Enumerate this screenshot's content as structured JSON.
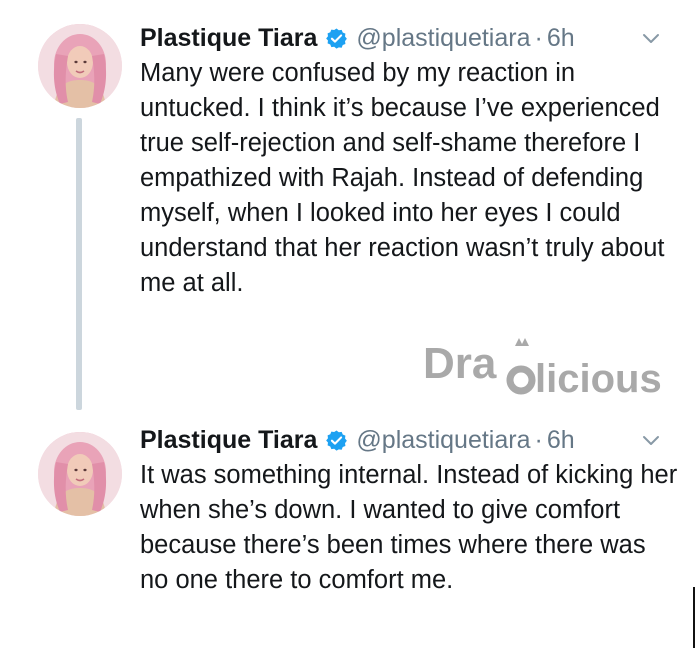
{
  "tweets": [
    {
      "name": "Plastique Tiara",
      "handle": "@plastiquetiara",
      "separator": "·",
      "time": "6h",
      "text": "Many were confused by my reaction in untucked. I think it’s because I’ve experienced true self-rejection and self-shame therefore I empathized with Rajah. Instead of defending myself, when I looked into her eyes I could understand that her reaction wasn’t truly about me at all."
    },
    {
      "name": "Plastique Tiara",
      "handle": "@plastiquetiara",
      "separator": "·",
      "time": "6h",
      "text": "It was something internal. Instead of kicking her when she’s down. I wanted to give comfort because there’s been times where there was no one there to comfort me."
    }
  ],
  "watermark": "Draglicious",
  "colors": {
    "verified": "#1da1f2",
    "secondary_text": "#657786",
    "thread_line": "#ccd6dd",
    "watermark": "#a9a9a9"
  },
  "icons": {
    "verified": "verified-badge-icon",
    "menu": "chevron-down-icon"
  }
}
